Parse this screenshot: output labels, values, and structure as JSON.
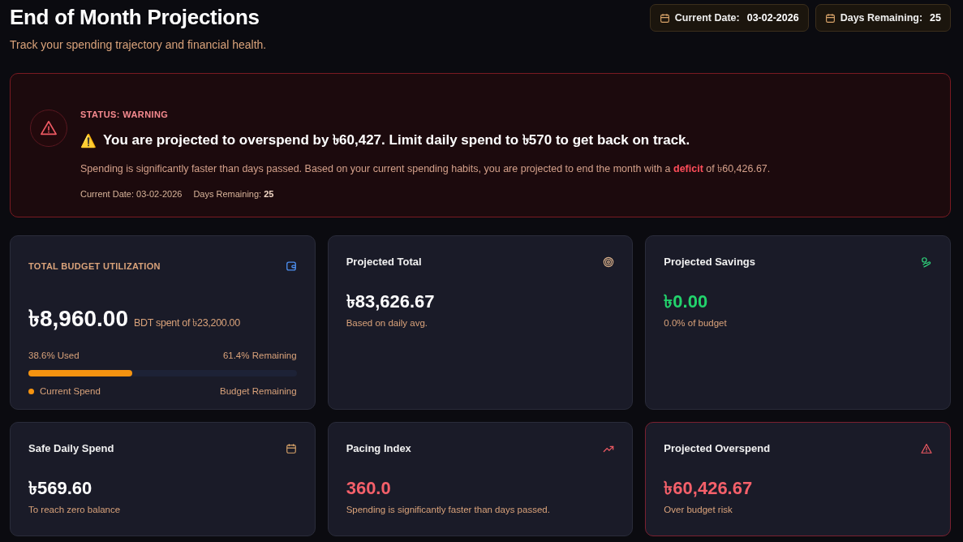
{
  "header": {
    "title": "End of Month Projections",
    "subtitle": "Track your spending trajectory and financial health.",
    "chips": [
      {
        "label": "Current Date:",
        "value": "03-02-2026"
      },
      {
        "label": "Days Remaining:",
        "value": "25"
      }
    ]
  },
  "banner": {
    "status": "STATUS: WARNING",
    "warning_glyph": "⚠️",
    "headline": "You are projected to overspend by ৳60,427. Limit daily spend to ৳570 to get back on track.",
    "detail": "Spending is significantly faster than days passed. Based on your current spending habits, you are projected to end the month with a **deficit** of ৳60,426.67.",
    "meta": [
      {
        "label": "Current Date:",
        "value": "03-02-2026",
        "emphasis": false
      },
      {
        "label": "Days Remaining:",
        "value": "25",
        "emphasis": true
      }
    ]
  },
  "cards": [
    {
      "kind": "utilization",
      "title": "TOTAL BUDGET UTILIZATION",
      "value": "৳8,960.00",
      "value_note": "BDT spent of ৳23,200.00",
      "used": "38.6% Used",
      "remaining": "61.4% Remaining",
      "level": 0.386,
      "legend_left": "Current Spend",
      "legend_right": "Budget Remaining",
      "color": "#ffffff",
      "alert": false
    },
    {
      "kind": "stat",
      "title": "Projected Total",
      "value": "৳83,626.67",
      "note": "Based on daily avg.",
      "color": "#ffffff",
      "alert": false
    },
    {
      "kind": "stat",
      "title": "Projected Savings",
      "value": "৳0.00",
      "note": "0.0% of budget",
      "color": "#22d36c",
      "alert": false
    },
    {
      "kind": "stat",
      "title": "Safe Daily Spend",
      "value": "৳569.60",
      "note": "To reach zero balance",
      "color": "#ffffff",
      "alert": false
    },
    {
      "kind": "stat",
      "title": "Pacing Index",
      "value": "360.0",
      "note": "Spending is significantly faster than days passed.",
      "color": "#f5606a",
      "alert": false
    },
    {
      "kind": "stat",
      "title": "Projected Overspend",
      "value": "৳60,426.67",
      "note": "Over budget risk",
      "color": "#f5606a",
      "alert": true
    }
  ]
}
